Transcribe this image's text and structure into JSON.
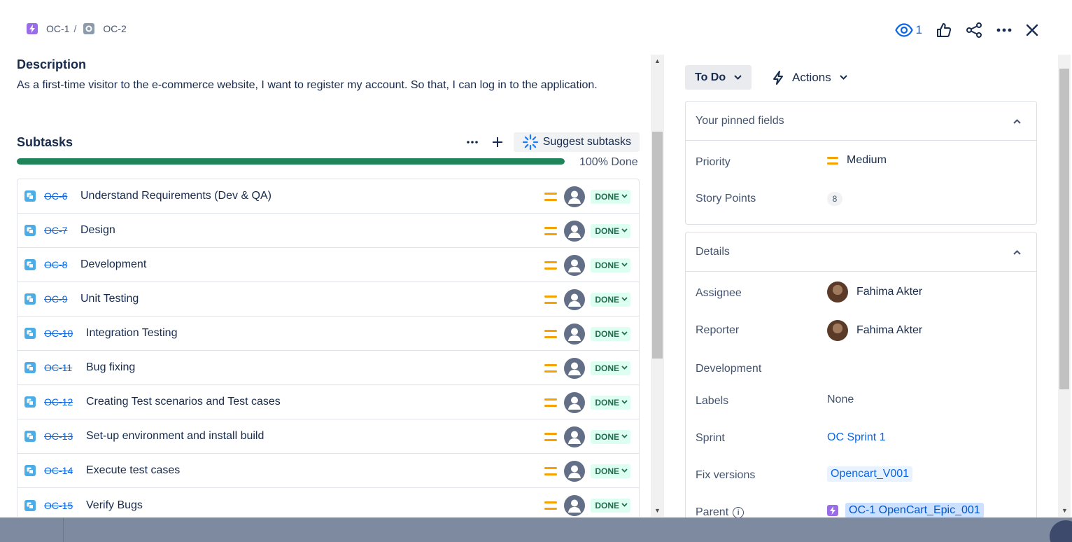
{
  "breadcrumb": {
    "parent_key": "OC-1",
    "separator": "/",
    "current_key": "OC-2"
  },
  "top_actions": {
    "watch_count": "1"
  },
  "description": {
    "title": "Description",
    "text": "As a first-time visitor to the e-commerce website, I want to register my account. So that, I can log in to the application."
  },
  "subtasks": {
    "title": "Subtasks",
    "suggest_label": "Suggest subtasks",
    "progress_percent": 100,
    "progress_label": "100% Done",
    "items": [
      {
        "key": "OC-6",
        "summary": "Understand Requirements (Dev & QA)",
        "status": "DONE"
      },
      {
        "key": "OC-7",
        "summary": "Design",
        "status": "DONE"
      },
      {
        "key": "OC-8",
        "summary": "Development",
        "status": "DONE"
      },
      {
        "key": "OC-9",
        "summary": "Unit Testing",
        "status": "DONE"
      },
      {
        "key": "OC-10",
        "summary": "Integration Testing",
        "status": "DONE"
      },
      {
        "key": "OC-11",
        "summary": "Bug fixing",
        "status": "DONE"
      },
      {
        "key": "OC-12",
        "summary": "Creating Test scenarios and Test cases",
        "status": "DONE"
      },
      {
        "key": "OC-13",
        "summary": "Set-up environment and install build",
        "status": "DONE"
      },
      {
        "key": "OC-14",
        "summary": "Execute test cases",
        "status": "DONE"
      },
      {
        "key": "OC-15",
        "summary": "Verify Bugs",
        "status": "DONE"
      }
    ]
  },
  "sidebar": {
    "status_button": "To Do",
    "actions_button": "Actions",
    "pinned": {
      "title": "Your pinned fields",
      "priority_label": "Priority",
      "priority_value": "Medium",
      "story_points_label": "Story Points",
      "story_points_value": "8"
    },
    "details": {
      "title": "Details",
      "assignee_label": "Assignee",
      "assignee_value": "Fahima Akter",
      "reporter_label": "Reporter",
      "reporter_value": "Fahima Akter",
      "development_label": "Development",
      "labels_label": "Labels",
      "labels_value": "None",
      "sprint_label": "Sprint",
      "sprint_value": "OC Sprint 1",
      "fix_versions_label": "Fix versions",
      "fix_versions_value": "Opencart_V001",
      "parent_label": "Parent",
      "parent_value": "OC-1 OpenCart_Epic_001"
    }
  },
  "colors": {
    "accent": "#0c66e4",
    "done_green": "#1f845a",
    "priority_medium": "#f5a100",
    "epic_purple": "#9a6ce8",
    "subtask_blue": "#4bade8"
  }
}
